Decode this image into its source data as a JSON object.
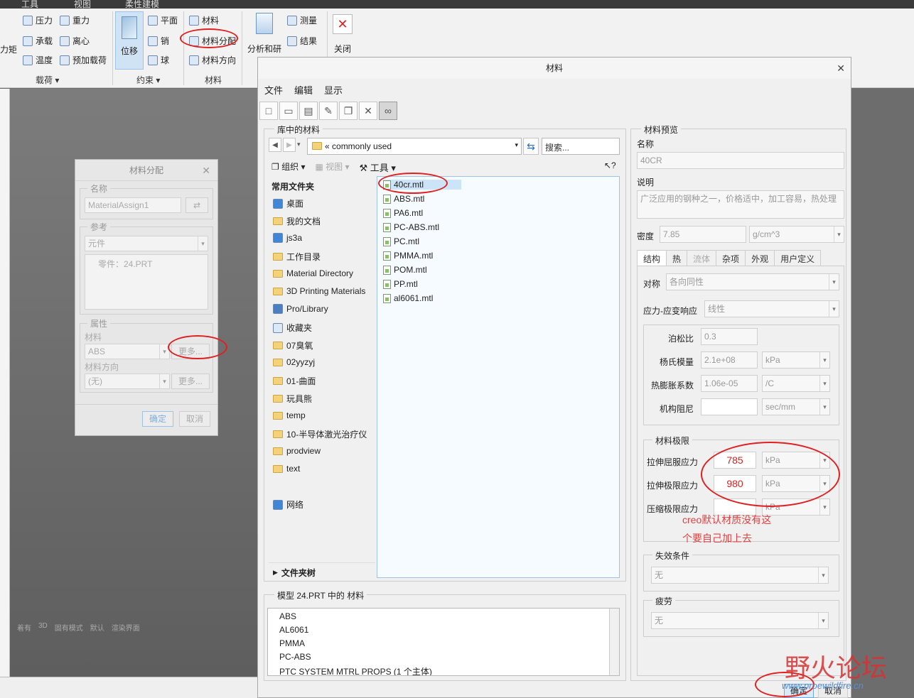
{
  "ribbon": {
    "top_tabs": [
      "工具",
      "视图",
      "柔性建模"
    ],
    "loads": {
      "items": [
        "压力",
        "重力",
        "承载",
        "离心",
        "温度",
        "预加载荷"
      ],
      "left_cut": "力矩",
      "group": "载荷"
    },
    "constraints": {
      "big": "位移",
      "items": [
        "平面",
        "销",
        "球"
      ],
      "group": "约束"
    },
    "materials": {
      "items": [
        "材料",
        "材料分配",
        "材料方向"
      ],
      "group": "材料"
    },
    "analysis": {
      "big": "分析和研",
      "items": [
        "测量",
        "结果"
      ]
    },
    "close": "关闭"
  },
  "viewport_status": [
    "着有",
    "3D",
    "固有模式",
    "默认",
    "渲染界面"
  ],
  "assign_dialog": {
    "title": "材料分配",
    "name_legend": "名称",
    "name_value": "MaterialAssign1",
    "ref_legend": "参考",
    "ref_combo": "元件",
    "ref_item": "零件：24.PRT",
    "props_legend": "属性",
    "material_label": "材料",
    "material_value": "ABS",
    "more": "更多...",
    "orientation_label": "材料方向",
    "orientation_value": "(无)",
    "ok": "确定",
    "cancel": "取消"
  },
  "material_dialog": {
    "title": "材料",
    "menu": [
      "文件",
      "编辑",
      "显示"
    ],
    "library": {
      "legend": "库中的材料",
      "path": "commonly used",
      "search_placeholder": "搜索...",
      "organize": "组织",
      "views": "视图",
      "tools": "工具",
      "nav_header": "常用文件夹",
      "nav": [
        "桌面",
        "我的文档",
        "js3a",
        "工作目录",
        "Material Directory",
        "3D Printing Materials",
        "Pro/Library",
        "收藏夹",
        "07臭氧",
        "02yyzyj",
        "01-曲面",
        "玩具熊",
        "temp",
        "10-半导体激光治疗仪",
        "prodview",
        "text"
      ],
      "network": "网络",
      "folder_tree": "文件夹树",
      "files": [
        "40cr.mtl",
        "ABS.mtl",
        "PA6.mtl",
        "PC-ABS.mtl",
        "PC.mtl",
        "PMMA.mtl",
        "POM.mtl",
        "PP.mtl",
        "al6061.mtl"
      ]
    },
    "model": {
      "legend": "模型 24.PRT 中的 材料",
      "items": [
        "ABS",
        "AL6061",
        "PMMA",
        "PC-ABS",
        "PTC SYSTEM MTRL PROPS (1 个主体)"
      ]
    },
    "preview": {
      "legend": "材料预览",
      "name_label": "名称",
      "name_value": "40CR",
      "desc_label": "说明",
      "desc_value": "广泛应用的钢种之一，价格适中，加工容易，热处理",
      "density_label": "密度",
      "density_value": "7.85",
      "density_unit": "g/cm^3",
      "tabs": [
        "结构",
        "热",
        "流体",
        "杂项",
        "外观",
        "用户定义"
      ],
      "symmetry_label": "对称",
      "symmetry_value": "各向同性",
      "stress_label": "应力-应变响应",
      "stress_value": "线性",
      "poisson_label": "泊松比",
      "poisson_value": "0.3",
      "young_label": "杨氏模量",
      "young_value": "2.1e+08",
      "young_unit": "kPa",
      "thermal_label": "热膨胀系数",
      "thermal_value": "1.06e-05",
      "thermal_unit": "/C",
      "damping_label": "机构阻尼",
      "damping_unit": "sec/mm",
      "limits_legend": "材料极限",
      "tensile_yield_label": "拉伸屈服应力",
      "tensile_yield_value": "785",
      "tensile_ultimate_label": "拉伸极限应力",
      "tensile_ultimate_value": "980",
      "compress_label": "压缩极限应力",
      "unit_kpa": "kPa",
      "failure_legend": "失效条件",
      "failure_value": "无",
      "fatigue_legend": "疲劳",
      "fatigue_value": "无"
    },
    "ok": "确定",
    "cancel": "取消"
  },
  "annotation": {
    "line1": "creo默认材质没有这",
    "line2": "个要自己加上去"
  },
  "watermark": {
    "text": "野火论坛",
    "url": "www.proewildfire.cn"
  },
  "colors": {
    "annotation_red": "#e02020",
    "selection_blue": "#cce4f7"
  }
}
